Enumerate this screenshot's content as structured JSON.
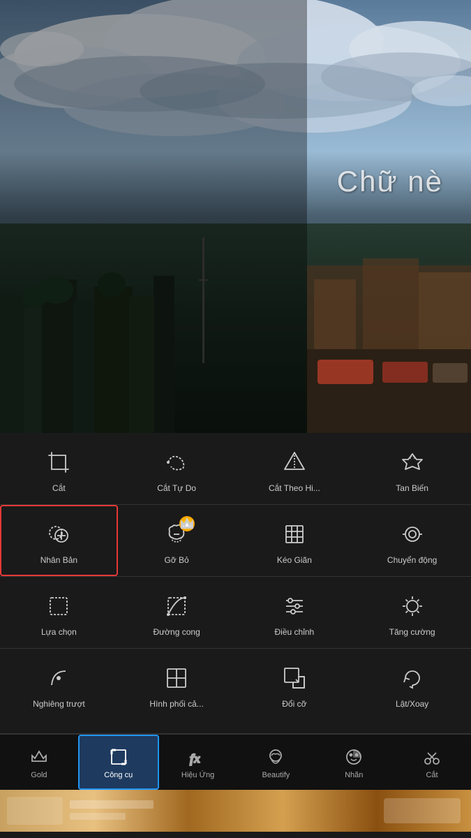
{
  "photo": {
    "overlay_text": "Chữ nè"
  },
  "tools": {
    "rows": [
      [
        {
          "id": "cat",
          "label": "Cắt",
          "icon": "crop"
        },
        {
          "id": "cat-tu-do",
          "label": "Cắt Tự Do",
          "icon": "freecut"
        },
        {
          "id": "cat-theo-hinh",
          "label": "Cắt Theo Hi...",
          "icon": "shapecrop"
        },
        {
          "id": "tan-bien",
          "label": "Tan Biến",
          "icon": "scatter"
        }
      ],
      [
        {
          "id": "nhan-ban",
          "label": "Nhân Bản",
          "icon": "clone",
          "active": true
        },
        {
          "id": "go-bo",
          "label": "Gỡ Bỏ",
          "icon": "remove",
          "crown": true
        },
        {
          "id": "keo-gian",
          "label": "Kéo Giãn",
          "icon": "stretch"
        },
        {
          "id": "chuyen-dong",
          "label": "Chuyển động",
          "icon": "motion"
        }
      ],
      [
        {
          "id": "lua-chon",
          "label": "Lựa chọn",
          "icon": "select"
        },
        {
          "id": "duong-cong",
          "label": "Đường cong",
          "icon": "curve"
        },
        {
          "id": "dieu-chinh",
          "label": "Điều chỉnh",
          "icon": "adjust"
        },
        {
          "id": "tang-cuong",
          "label": "Tăng cường",
          "icon": "enhance"
        }
      ],
      [
        {
          "id": "nghieng-truot",
          "label": "Nghiêng trượt",
          "icon": "tilt"
        },
        {
          "id": "hinh-phoi-ca",
          "label": "Hình phối cả...",
          "icon": "collage"
        },
        {
          "id": "doi-co",
          "label": "Đổi cỡ",
          "icon": "resize"
        },
        {
          "id": "lat-xoay",
          "label": "Lật/Xoay",
          "icon": "rotate"
        }
      ]
    ]
  },
  "bottom_nav": [
    {
      "id": "gold",
      "label": "Gold",
      "icon": "crown"
    },
    {
      "id": "cong-cu",
      "label": "Công cụ",
      "icon": "crop-nav",
      "active": true
    },
    {
      "id": "hieu-ung",
      "label": "Hiệu Ứng",
      "icon": "fx"
    },
    {
      "id": "beautify",
      "label": "Beautify",
      "icon": "face"
    },
    {
      "id": "nhan",
      "label": "Nhãn",
      "icon": "sticker"
    },
    {
      "id": "cat-nav",
      "label": "Cắt",
      "icon": "scissors"
    }
  ]
}
